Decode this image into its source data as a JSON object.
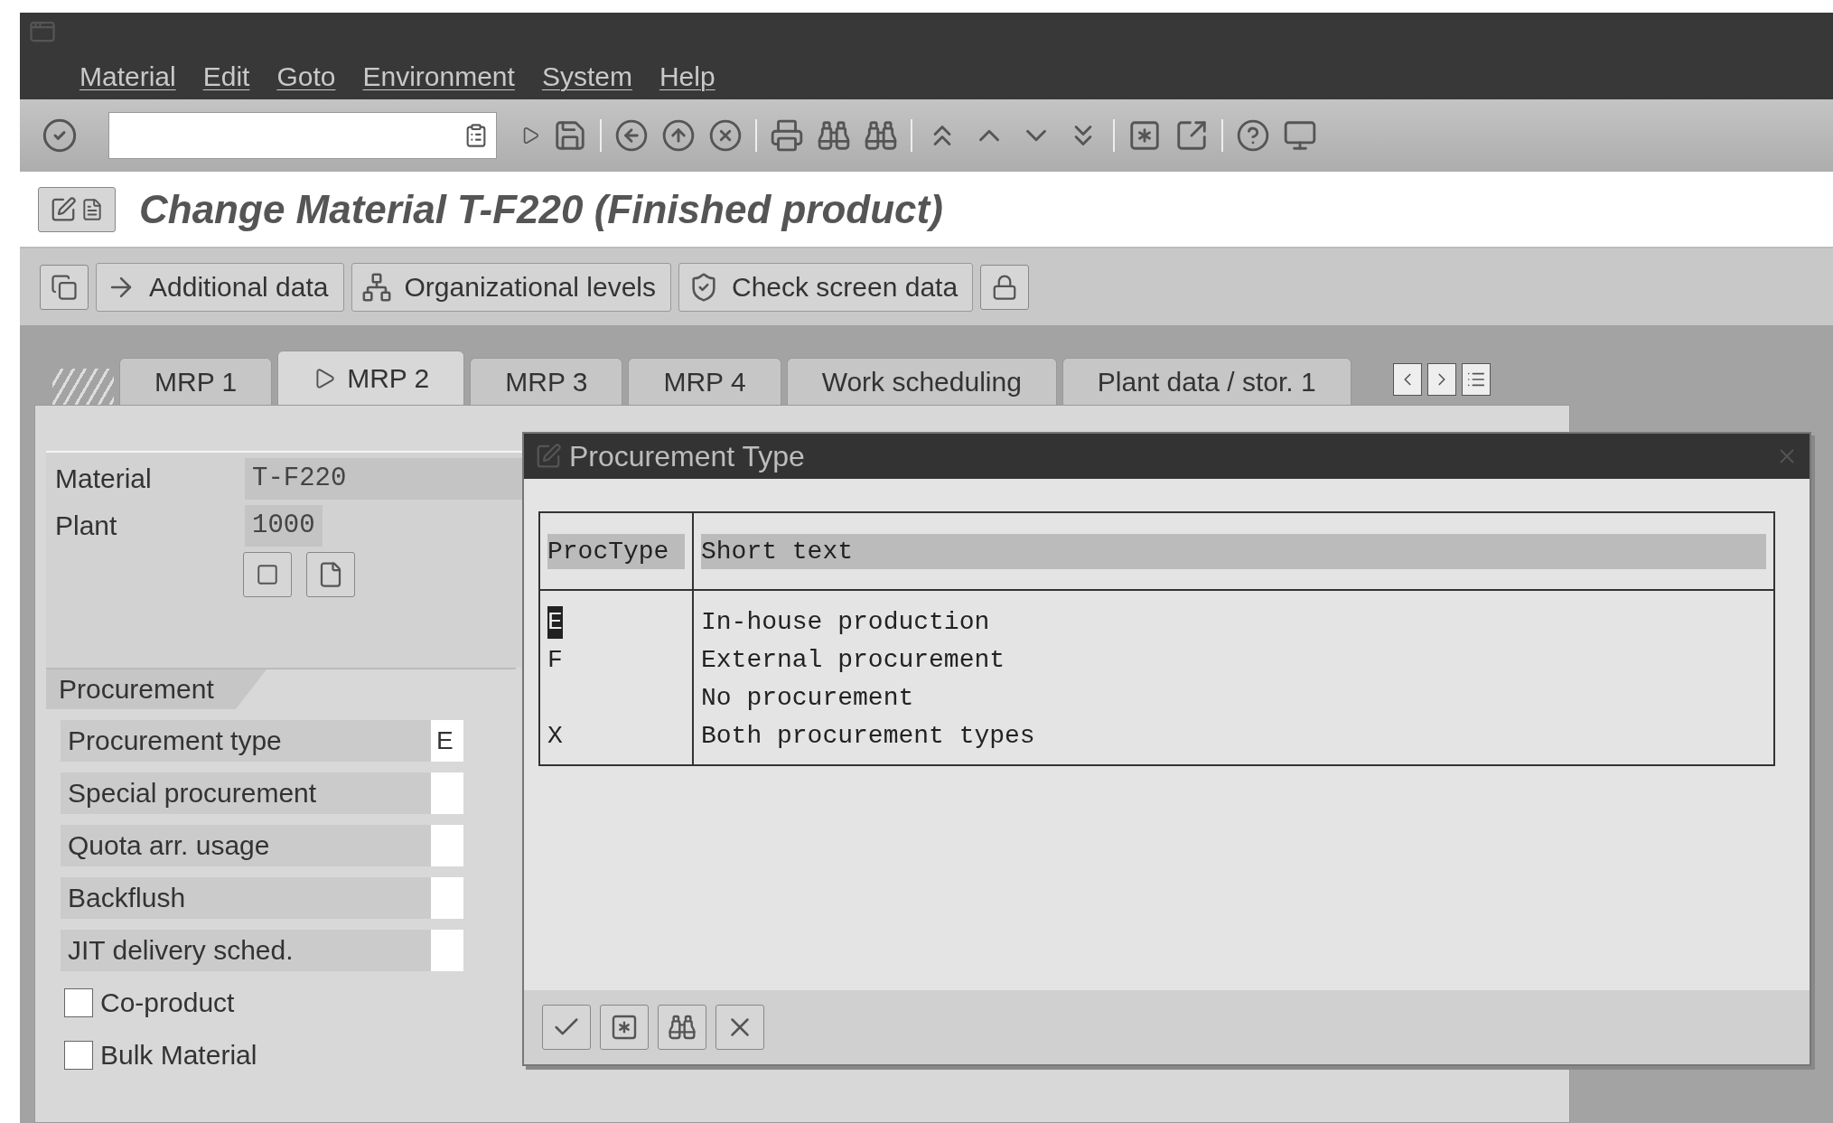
{
  "menu_bar": {
    "items": [
      "Material",
      "Edit",
      "Goto",
      "Environment",
      "System",
      "Help"
    ]
  },
  "title_bar": {
    "title": "Change Material T-F220 (Finished product)"
  },
  "app_toolbar": {
    "buttons": [
      {
        "kind": "arrow",
        "label": "Additional data"
      },
      {
        "kind": "hierarchy",
        "label": "Organizational levels"
      },
      {
        "kind": "check",
        "label": "Check screen data"
      }
    ]
  },
  "tabs": [
    {
      "label": "MRP 1",
      "selected": false
    },
    {
      "label": "MRP 2",
      "selected": true
    },
    {
      "label": "MRP 3",
      "selected": false
    },
    {
      "label": "MRP 4",
      "selected": false
    },
    {
      "label": "Work scheduling",
      "selected": false
    },
    {
      "label": "Plant data / stor. 1",
      "selected": false
    }
  ],
  "header": {
    "fields": [
      {
        "label": "Material",
        "value": "T-F220"
      },
      {
        "label": "Plant",
        "value": "1000"
      }
    ]
  },
  "procurement": {
    "title": "Procurement",
    "fields": [
      {
        "label": "Procurement type",
        "value": "E"
      },
      {
        "label": "Special procurement"
      },
      {
        "label": "Quota arr. usage"
      },
      {
        "label": "Backflush"
      },
      {
        "label": "JIT delivery sched."
      }
    ],
    "checkboxes": [
      {
        "label": "Co-product",
        "checked": false
      },
      {
        "label": "Bulk Material",
        "checked": false
      }
    ]
  },
  "dialog": {
    "title": "Procurement Type",
    "columns": [
      "ProcType",
      "Short text"
    ],
    "rows": [
      {
        "code": "E",
        "text": "In-house production",
        "selected": true
      },
      {
        "code": "F",
        "text": "External procurement",
        "selected": false
      },
      {
        "text": "No procurement",
        "selected": false
      },
      {
        "code": "X",
        "text": "Both procurement types",
        "selected": false
      }
    ]
  }
}
